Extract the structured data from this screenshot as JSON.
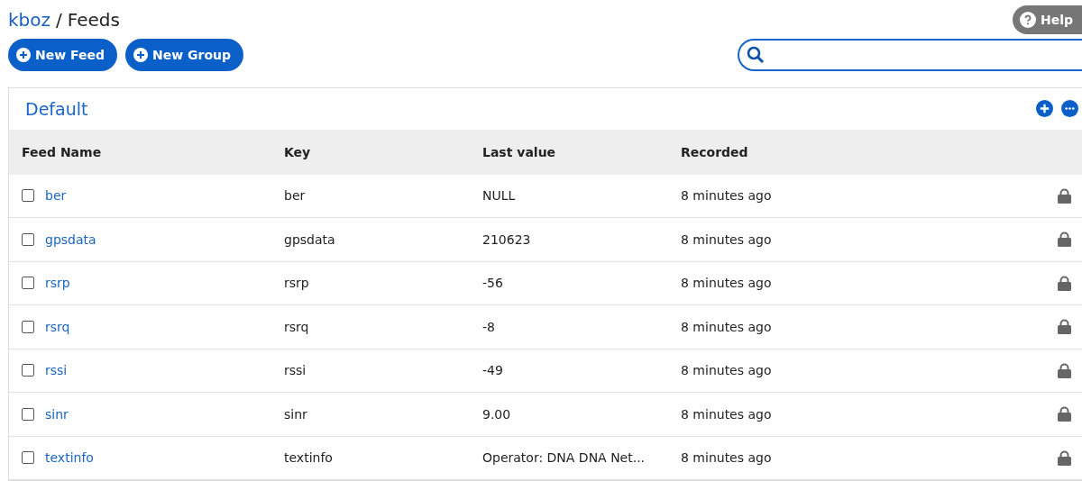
{
  "breadcrumb": {
    "owner": "kboz",
    "separator": "/",
    "page": "Feeds"
  },
  "help_button": {
    "label": "Help"
  },
  "actions": [
    "New Feed",
    "New Group"
  ],
  "group": {
    "title": "Default",
    "columns": [
      "Feed Name",
      "Key",
      "Last value",
      "Recorded"
    ],
    "rows": [
      {
        "name": "ber",
        "key": "ber",
        "last_value": "NULL",
        "recorded": "8 minutes ago",
        "checked": false
      },
      {
        "name": "gpsdata",
        "key": "gpsdata",
        "last_value": "210623",
        "recorded": "8 minutes ago",
        "checked": false
      },
      {
        "name": "rsrp",
        "key": "rsrp",
        "last_value": "-56",
        "recorded": "8 minutes ago",
        "checked": false
      },
      {
        "name": "rsrq",
        "key": "rsrq",
        "last_value": "-8",
        "recorded": "8 minutes ago",
        "checked": false
      },
      {
        "name": "rssi",
        "key": "rssi",
        "last_value": "-49",
        "recorded": "8 minutes ago",
        "checked": false
      },
      {
        "name": "sinr",
        "key": "sinr",
        "last_value": "9.00",
        "recorded": "8 minutes ago",
        "checked": false
      },
      {
        "name": "textinfo",
        "key": "textinfo",
        "last_value": "Operator: DNA DNA Net...",
        "recorded": "8 minutes ago",
        "checked": false
      }
    ]
  }
}
